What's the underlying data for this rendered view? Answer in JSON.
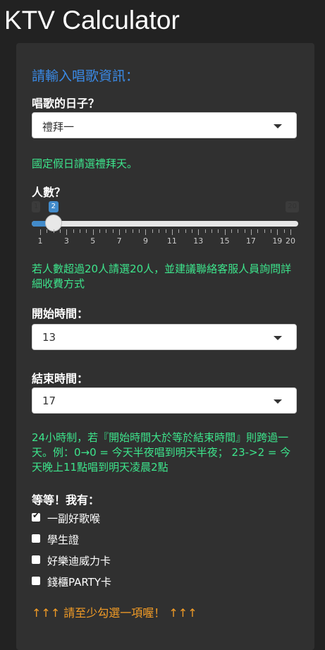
{
  "app": {
    "title": "KTV Calculator"
  },
  "form": {
    "section_title": "請輸入唱歌資訊：",
    "day": {
      "label": "唱歌的日子？",
      "value": "禮拜一",
      "note": "國定假日請選禮拜天。"
    },
    "people": {
      "label": "人數？",
      "min": 1,
      "max": 20,
      "value": 2,
      "min_label": "1",
      "max_label": "20",
      "value_label": "2",
      "tick_labels": [
        "1",
        "3",
        "5",
        "7",
        "9",
        "11",
        "13",
        "15",
        "17",
        "19",
        "20"
      ],
      "note": "若人數超過20人請選20人，並建議聯絡客服人員詢問詳細收費方式"
    },
    "start_time": {
      "label": "開始時間：",
      "value": "13"
    },
    "end_time": {
      "label": "結束時間：",
      "value": "17",
      "note": "24小時制，若『開始時間大於等於結束時間』則跨過一天。例：0→0 = 今天半夜唱到明天半夜； 23->2 = 今天晚上11點唱到明天凌晨2點"
    },
    "extras": {
      "label": "等等！我有：",
      "options": [
        {
          "label": "一副好歌喉",
          "checked": true
        },
        {
          "label": "學生證",
          "checked": false
        },
        {
          "label": "好樂迪威力卡",
          "checked": false
        },
        {
          "label": "錢櫃PARTY卡",
          "checked": false
        }
      ],
      "warning": "↑↑↑ 請至少勾選一項喔！ ↑↑↑"
    }
  },
  "colors": {
    "background": "#222222",
    "panel": "#303030",
    "accent_blue": "#3a8ae6",
    "note_green": "#3de58c",
    "warning_orange": "#f39c26",
    "slider_fill": "#428bca"
  }
}
